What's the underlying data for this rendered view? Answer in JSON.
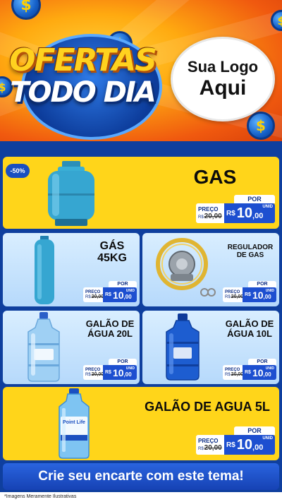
{
  "header": {
    "title_line1": "OFERTAS",
    "title_line2": "TODO DIA",
    "logo_line1": "Sua Logo",
    "logo_line2": "Aqui",
    "coin_symbol": "$"
  },
  "colors": {
    "header_orange": "#f0590f",
    "header_yellow": "#ffd23a",
    "background_blue": "#0f3f9e",
    "card_yellow": "#ffd51a",
    "card_light_blue": "#d9eeff",
    "price_blue": "#1d4fd0",
    "cylinder_blue": "#36a6d1",
    "water_blue": "#1d5dd0"
  },
  "products": [
    {
      "name": "GAS",
      "discount": "-50%",
      "image": "gas-cylinder-icon",
      "price": {
        "por": "POR",
        "preco": "PREÇO",
        "old_currency": "R$",
        "old_value": "20,00",
        "currency": "R$",
        "integer": "10",
        "decimals": ",00",
        "unit": "UNID"
      }
    },
    {
      "name_line1": "GÁS",
      "name_line2": "45KG",
      "image": "tall-gas-cylinder-icon",
      "price": {
        "por": "POR",
        "preco": "PREÇO",
        "old_currency": "R$",
        "old_value": "20,00",
        "currency": "R$",
        "integer": "10",
        "decimals": ",00",
        "unit": "UNID"
      }
    },
    {
      "name_line1": "REGULADOR",
      "name_line2": "DE GAS",
      "image": "gas-regulator-icon",
      "price": {
        "por": "POR",
        "preco": "PREÇO",
        "old_currency": "R$",
        "old_value": "20,00",
        "currency": "R$",
        "integer": "10",
        "decimals": ",00",
        "unit": "UNID"
      }
    },
    {
      "name_line1": "GALÃO DE",
      "name_line2": "ÁGUA 20L",
      "image": "water-jug-20l-icon",
      "price": {
        "por": "POR",
        "preco": "PREÇO",
        "old_currency": "R$",
        "old_value": "20,00",
        "currency": "R$",
        "integer": "10",
        "decimals": ",00",
        "unit": "UNID"
      }
    },
    {
      "name_line1": "GALÃO DE",
      "name_line2": "ÁGUA 10L",
      "image": "water-jug-10l-icon",
      "price": {
        "por": "POR",
        "preco": "PREÇO",
        "old_currency": "R$",
        "old_value": "20,00",
        "currency": "R$",
        "integer": "10",
        "decimals": ",00",
        "unit": "UNID"
      }
    },
    {
      "name": "GALÃO DE AGUA 5L",
      "image": "water-bottle-5l-icon",
      "bottle_label": "Point Life",
      "price": {
        "por": "POR",
        "preco": "PREÇO",
        "old_currency": "R$",
        "old_value": "20,00",
        "currency": "R$",
        "integer": "10",
        "decimals": ",00",
        "unit": "UNID"
      }
    }
  ],
  "cta": "Crie seu encarte com este tema!",
  "footnote": "*Imagens Meramente Ilustrativas"
}
